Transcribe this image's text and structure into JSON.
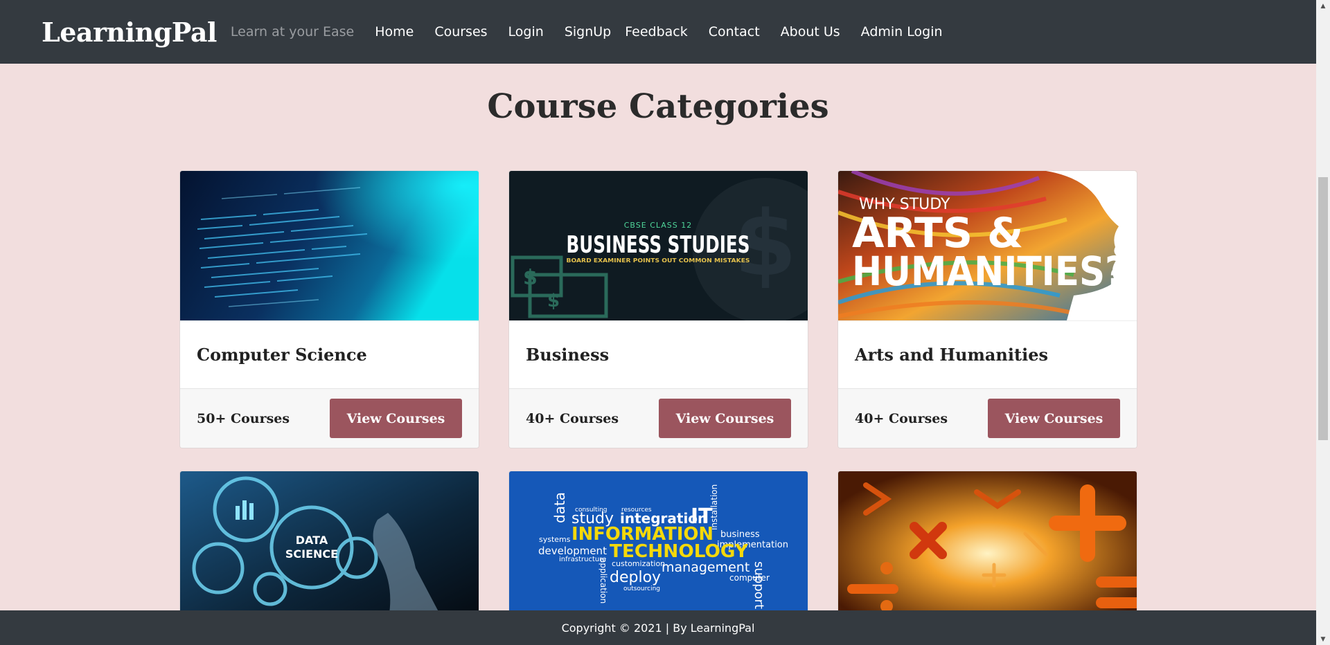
{
  "navbar": {
    "brand": "LearningPal",
    "tagline": "Learn at your Ease",
    "links": [
      "Home",
      "Courses",
      "Login",
      "SignUp",
      "Feedback",
      "Contact",
      "About Us",
      "Admin Login"
    ]
  },
  "heading": "Course Categories",
  "cards": [
    {
      "title": "Computer Science",
      "count": "50+ Courses",
      "button": "View Courses"
    },
    {
      "title": "Business",
      "count": "40+ Courses",
      "button": "View Courses",
      "img_text": {
        "line1": "CBSE CLASS 12",
        "line2": "BUSINESS STUDIES",
        "line3": "BOARD EXAMINER POINTS OUT COMMON MISTAKES"
      }
    },
    {
      "title": "Arts and Humanities",
      "count": "40+ Courses",
      "button": "View Courses",
      "img_text": {
        "line1": "WHY STUDY",
        "line2": "ARTS &",
        "line3": "HUMANITIES?"
      }
    },
    {
      "img_text": {
        "line1": "DATA",
        "line2": "SCIENCE"
      }
    },
    {
      "img_text": {
        "line1": "INFORMATION",
        "line2": "TECHNOLOGY",
        "words": [
          "data",
          "study",
          "integration",
          "IT",
          "systems",
          "development",
          "business",
          "implementation",
          "deploy",
          "management",
          "computer",
          "support",
          "application",
          "infrastructure",
          "customization",
          "outsourcing",
          "resources",
          "consulting",
          "installation"
        ]
      }
    },
    {}
  ],
  "footer": "Copyright © 2021 | By LearningPal",
  "colors": {
    "navbar": "#343a40",
    "page_bg": "#f2dede",
    "button": "#9b555e"
  }
}
